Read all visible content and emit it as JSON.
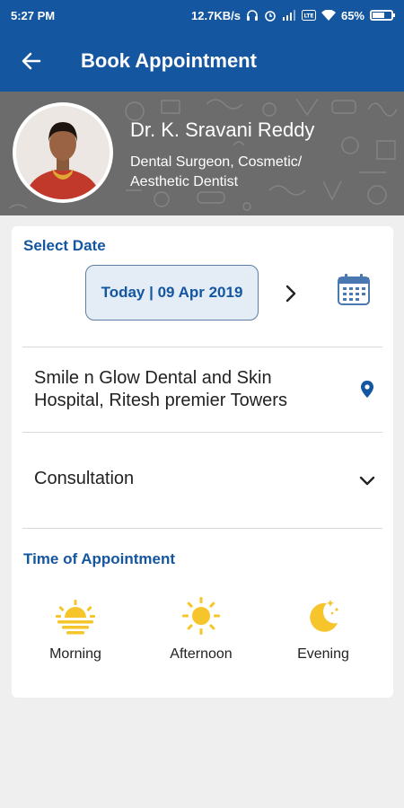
{
  "status_bar": {
    "time": "5:27 PM",
    "speed": "12.7KB/s",
    "battery": "65%",
    "battery_level": 0.65
  },
  "app_bar": {
    "title": "Book Appointment"
  },
  "doctor": {
    "name": "Dr. K. Sravani Reddy",
    "specialty": "Dental Surgeon, Cosmetic/ Aesthetic Dentist"
  },
  "select_date": {
    "label": "Select Date",
    "value": "Today | 09 Apr 2019"
  },
  "location": {
    "name": "Smile n Glow Dental and Skin Hospital, Ritesh premier Towers"
  },
  "service": {
    "value": "Consultation"
  },
  "time_of_appointment": {
    "label": "Time of Appointment",
    "slots": [
      {
        "label": "Morning",
        "icon": "sunrise-icon"
      },
      {
        "label": "Afternoon",
        "icon": "sun-icon"
      },
      {
        "label": "Evening",
        "icon": "moon-icon"
      }
    ]
  },
  "colors": {
    "primary": "#1456a0",
    "accent_yellow": "#f6c52b"
  }
}
